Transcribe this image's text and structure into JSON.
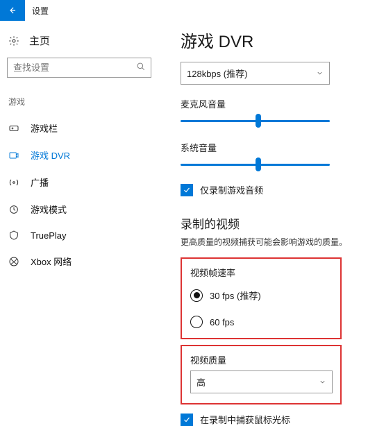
{
  "titlebar": {
    "app": "设置"
  },
  "left": {
    "home": "主页",
    "search_placeholder": "查找设置",
    "section": "游戏",
    "items": [
      {
        "label": "游戏栏"
      },
      {
        "label": "游戏 DVR"
      },
      {
        "label": "广播"
      },
      {
        "label": "游戏模式"
      },
      {
        "label": "TruePlay"
      },
      {
        "label": "Xbox 网络"
      }
    ]
  },
  "main": {
    "title": "游戏 DVR",
    "bitrate": "128kbps (推荐)",
    "mic_label": "麦克风音量",
    "mic_pct": 52,
    "sys_label": "系统音量",
    "sys_pct": 52,
    "rec_audio_only": "仅录制游戏音频",
    "rec_audio_only_checked": true,
    "video_section": "录制的视频",
    "video_hint": "更高质量的视频捕获可能会影响游戏的质量。",
    "fps_label": "视频帧速率",
    "fps_options": [
      "30 fps (推荐)",
      "60 fps"
    ],
    "fps_selected": 0,
    "quality_label": "视频质量",
    "quality_value": "高",
    "cursor_label": "在录制中捕获鼠标光标",
    "cursor_checked": true
  }
}
